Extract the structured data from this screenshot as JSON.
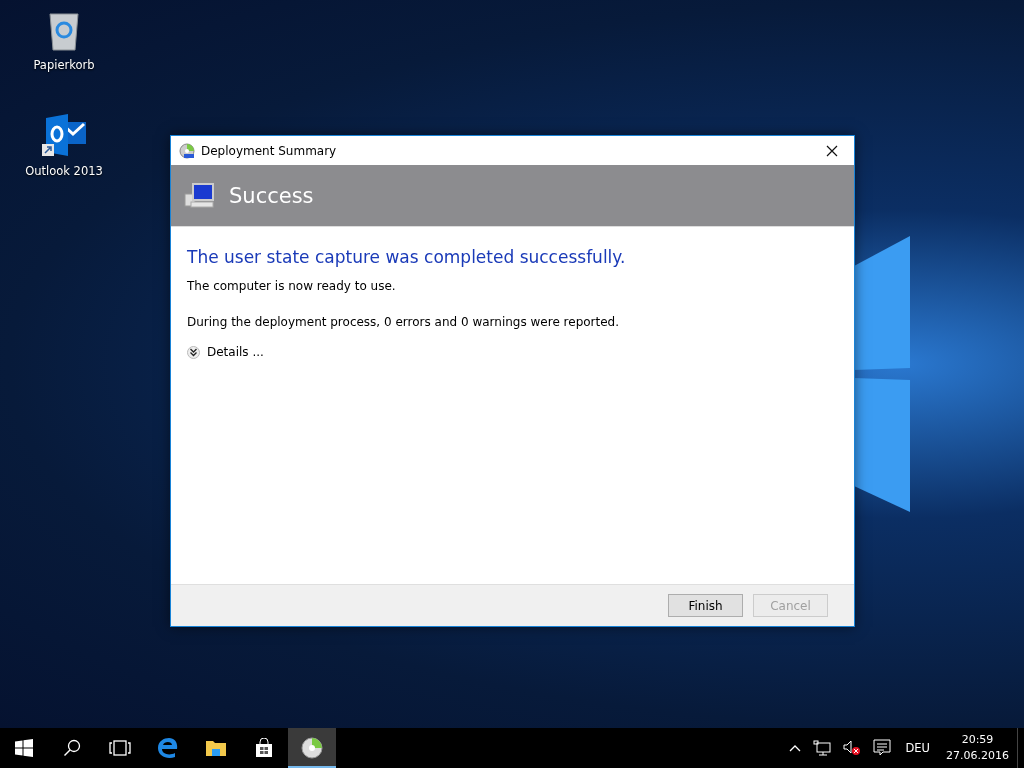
{
  "desktop_icons": [
    {
      "kind": "recycle-bin",
      "label": "Papierkorb"
    },
    {
      "kind": "outlook",
      "label": "Outlook 2013"
    }
  ],
  "window": {
    "title": "Deployment Summary",
    "active": true
  },
  "banner": {
    "title": "Success"
  },
  "content": {
    "heading": "The user state capture was completed successfully.",
    "lines": [
      "The computer is now ready to use.",
      "During the deployment process, 0 errors and 0 warnings were reported."
    ],
    "details": {
      "label": "Details ...",
      "expanded": false
    }
  },
  "buttons": [
    {
      "label": "Finish",
      "disabled": false
    },
    {
      "label": "Cancel",
      "disabled": true
    }
  ],
  "taskbar": {
    "items": [
      {
        "kind": "start",
        "active": false
      },
      {
        "kind": "search",
        "active": false
      },
      {
        "kind": "task-view",
        "active": false
      },
      {
        "kind": "edge",
        "active": false
      },
      {
        "kind": "explorer",
        "active": false
      },
      {
        "kind": "store",
        "active": false
      },
      {
        "kind": "deployment",
        "active": true
      }
    ],
    "tray": {
      "language": "DEU",
      "time": "20:59",
      "date": "27.06.2016",
      "sound_muted": true
    }
  }
}
